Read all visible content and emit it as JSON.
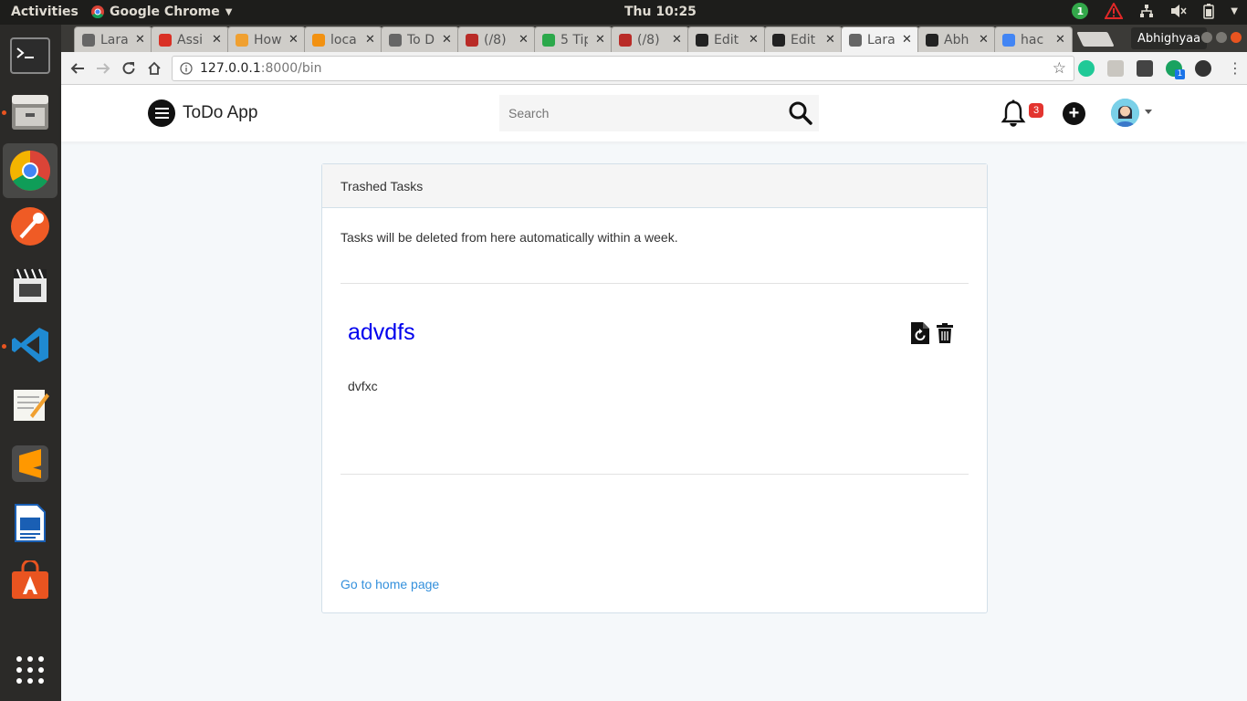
{
  "os_bar": {
    "activities": "Activities",
    "app_menu": "Google Chrome",
    "clock": "Thu 10:25",
    "update_badge": "1"
  },
  "dock": {
    "items": [
      "terminal-icon",
      "files-icon",
      "chrome-icon",
      "postman-icon",
      "video-editor-icon",
      "vscode-icon",
      "text-editor-icon",
      "sublime-icon",
      "writer-icon",
      "software-center-icon",
      "app-grid-icon"
    ]
  },
  "browser": {
    "tabs": [
      {
        "label": "Lara",
        "icon": "laravel-icon",
        "color": "#666"
      },
      {
        "label": "Assi",
        "icon": "gmail-icon",
        "color": "#d93025"
      },
      {
        "label": "How",
        "icon": "code-icon",
        "color": "#f0a030"
      },
      {
        "label": "loca",
        "icon": "phpmyadmin-icon",
        "color": "#f29111"
      },
      {
        "label": "To D",
        "icon": "page-icon",
        "color": "#666"
      },
      {
        "label": "(/8)",
        "icon": "quora-icon",
        "color": "#b92b27"
      },
      {
        "label": "5 Tip",
        "icon": "link-icon",
        "color": "#2ba84a"
      },
      {
        "label": "(/8)",
        "icon": "quora-icon",
        "color": "#b92b27"
      },
      {
        "label": "Edit",
        "icon": "github-icon",
        "color": "#222"
      },
      {
        "label": "Edit",
        "icon": "github-icon",
        "color": "#222"
      },
      {
        "label": "Lara",
        "icon": "page-icon",
        "color": "#666",
        "active": true
      },
      {
        "label": "Abh",
        "icon": "github-icon",
        "color": "#222"
      },
      {
        "label": "hac",
        "icon": "google-icon",
        "color": "#4285f4"
      }
    ],
    "profile_name": "Abhighyaa",
    "url_host": "127.0.0.1",
    "url_path": ":8000/bin",
    "extension_badge": "1"
  },
  "app": {
    "brand": "ToDo App",
    "search_placeholder": "Search",
    "notifications_count": "3"
  },
  "card": {
    "header": "Trashed Tasks",
    "note": "Tasks will be deleted from here automatically within a week.",
    "task": {
      "title": "advdfs",
      "description": "dvfxc"
    },
    "home_link": "Go to home page"
  }
}
